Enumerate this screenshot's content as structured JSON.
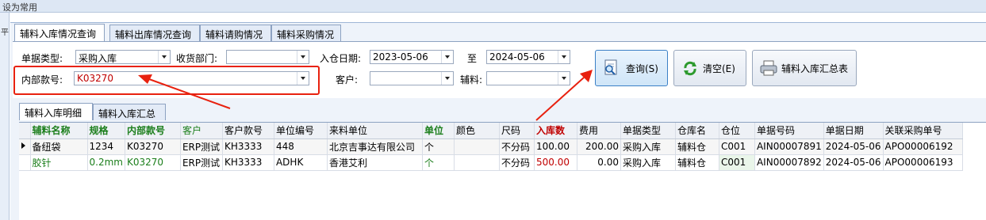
{
  "topbar": {
    "text": "设为常用"
  },
  "leftstrip": {
    "text": "平"
  },
  "tabs": [
    {
      "label": "辅料入库情况查询"
    },
    {
      "label": "辅料出库情况查询"
    },
    {
      "label": "辅料请购情况"
    },
    {
      "label": "辅料采购情况"
    }
  ],
  "form": {
    "doc_type_label": "单据类型:",
    "doc_type_value": "采购入库",
    "receiving_dept_label": "收货部门:",
    "receiving_dept_value": "",
    "in_date_label": "入仓日期:",
    "date_from": "2023-05-06",
    "date_to_label": "至",
    "date_to": "2024-05-06",
    "internal_no_label": "内部款号:",
    "internal_no_value": "K03270",
    "customer_label": "客户:",
    "customer_value": "",
    "material_label": "辅料:",
    "material_value": ""
  },
  "buttons": {
    "query": "查询(S)",
    "clear": "清空(E)",
    "summary": "辅料入库汇总表"
  },
  "subtabs": [
    {
      "label": "辅料入库明细"
    },
    {
      "label": "辅料入库汇总"
    }
  ],
  "grid": {
    "columns": [
      "辅料名称",
      "规格",
      "内部款号",
      "客户",
      "客户款号",
      "单位编号",
      "来料单位",
      "单位",
      "颜色",
      "尺码",
      "入库数",
      "费用",
      "单据类型",
      "仓库名",
      "仓位",
      "单据号码",
      "单据日期",
      "关联采购单号"
    ],
    "rows": [
      [
        "备纽袋",
        "1234",
        "K03270",
        "ERP测试",
        "KH3333",
        "448",
        "北京吉事达有限公司",
        "个",
        "",
        "不分码",
        "100.00",
        "200.00",
        "采购入库",
        "辅料仓",
        "C001",
        "AIN00007891",
        "2024-05-06",
        "APO00006192"
      ],
      [
        "胶针",
        "0.2mm",
        "K03270",
        "ERP测试",
        "KH3333",
        "ADHK",
        "香港艾利",
        "个",
        "",
        "不分码",
        "500.00",
        "0.00",
        "采购入库",
        "辅料仓",
        "C001",
        "AIN00007892",
        "2024-05-06",
        "APO00006193"
      ]
    ]
  },
  "colors": {
    "highlight_box": "#e8210f",
    "arrow": "#e8210f",
    "green_text": "#1b7e1b",
    "red_text": "#c00000"
  }
}
